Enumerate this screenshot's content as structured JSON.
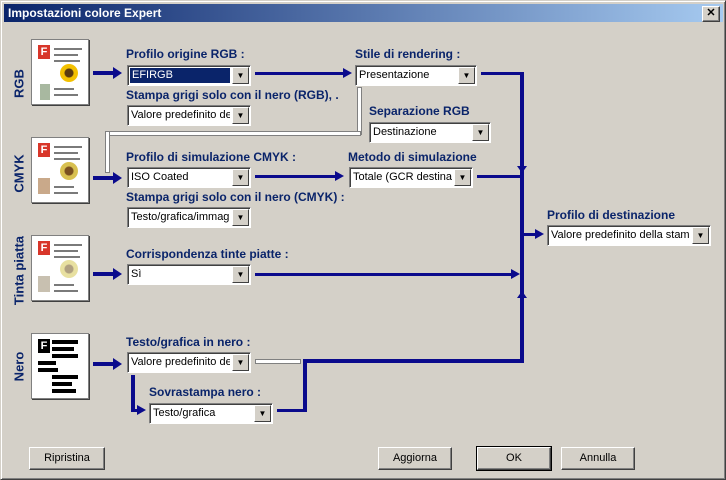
{
  "window": {
    "title": "Impostazioni colore Expert",
    "close_glyph": "✕"
  },
  "sections": {
    "rgb": "RGB",
    "cmyk": "CMYK",
    "tinta": "Tinta piatta",
    "nero": "Nero"
  },
  "rgb": {
    "profile_label": "Profilo origine RGB :",
    "profile_value": "EFIRGB",
    "gray_label": "Stampa grigi solo con il nero (RGB), .",
    "gray_value": "Valore predefinito dell",
    "render_label": "Stile di rendering :",
    "render_value": "Presentazione",
    "sep_label": "Separazione RGB",
    "sep_value": "Destinazione"
  },
  "cmyk": {
    "profile_label": "Profilo di simulazione CMYK :",
    "profile_value": "ISO Coated",
    "method_label": "Metodo di simulazione",
    "method_value": "Totale (GCR destinaz",
    "gray_label": "Stampa grigi solo con il nero (CMYK) :",
    "gray_value": "Testo/grafica/immagi"
  },
  "destination": {
    "label": "Profilo di destinazione",
    "value": "Valore predefinito della stampa"
  },
  "tinta": {
    "label": "Corrispondenza tinte piatte :",
    "value": "Sì"
  },
  "nero": {
    "text_label": "Testo/grafica in nero :",
    "text_value": "Valore predefinito dell",
    "overprint_label": "Sovrastampa nero :",
    "overprint_value": "Testo/grafica"
  },
  "buttons": {
    "reset": "Ripristina",
    "update": "Aggiorna",
    "ok": "OK",
    "cancel": "Annulla"
  },
  "icons": {
    "dropdown": "▼",
    "logo_glyph": "F"
  },
  "colors": {
    "accent": "#0a246a",
    "wire": "#0a0a8c",
    "background": "#d4d0c8"
  }
}
